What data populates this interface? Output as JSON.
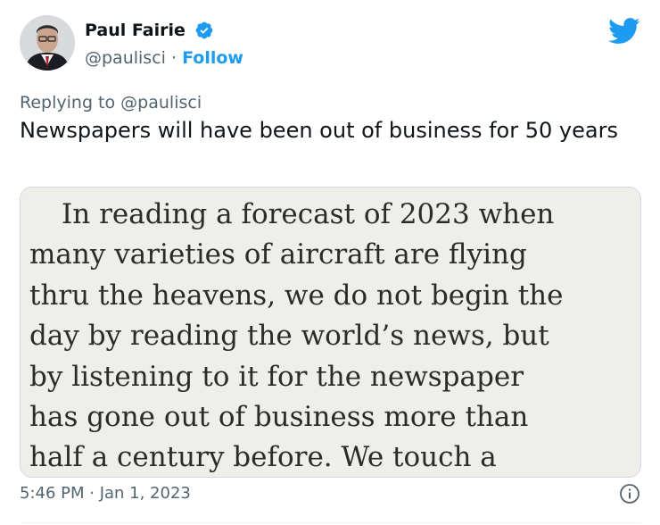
{
  "tweet": {
    "author": {
      "name": "Paul Fairie",
      "handle": "@paulisci",
      "separator": "·",
      "follow_label": "Follow",
      "verified": true
    },
    "reply_context": {
      "prefix": "Replying to",
      "handle": "@paulisci"
    },
    "text": "Newspapers will have been out of business for 50 years",
    "media": {
      "lines": [
        "In reading a forecast of 2023 when",
        "many varieties of aircraft are flying",
        "thru the heavens, we do not begin the",
        "day by reading the world’s news, but",
        "by listening to it for the newspaper",
        "has gone out of business more than",
        "half a century before.  We touch a"
      ]
    },
    "timestamp": "5:46 PM · Jan 1, 2023"
  },
  "icons": {
    "verified": "verified-badge-icon",
    "brand": "twitter-bird-icon",
    "info": "info-icon"
  },
  "colors": {
    "brand_blue": "#1d9bf0",
    "secondary_text": "#536471",
    "primary_text": "#0f1419"
  }
}
